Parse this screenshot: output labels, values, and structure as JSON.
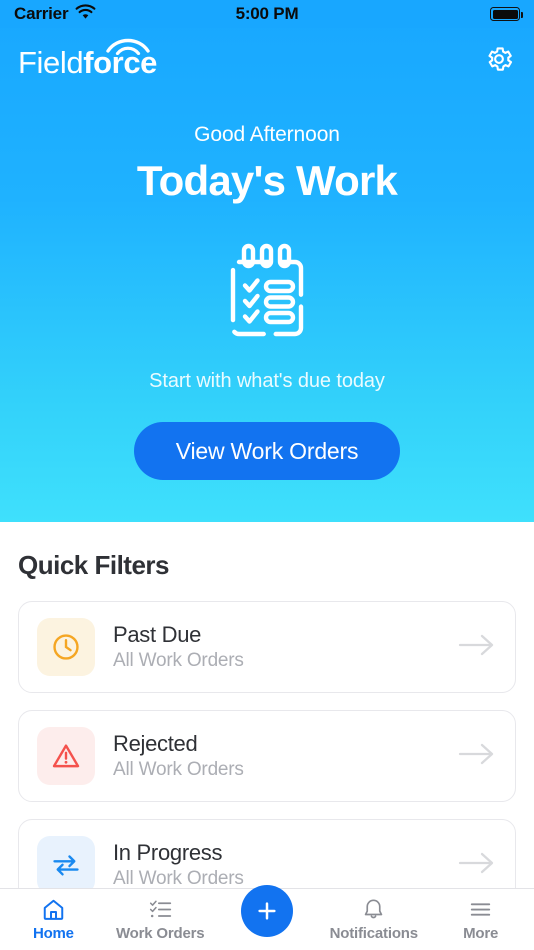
{
  "status_bar": {
    "carrier": "Carrier",
    "wifi_icon": "wifi-icon",
    "time": "5:00 PM",
    "battery_icon": "battery-full-icon"
  },
  "header": {
    "logo_part1": "Field",
    "logo_part2": "force",
    "logo_signal_icon": "signal-arc-icon",
    "settings_icon": "gear-icon"
  },
  "hero": {
    "greeting": "Good Afternoon",
    "title": "Today's Work",
    "illustration_icon": "clipboard-checklist-icon",
    "subtitle": "Start with what's due today",
    "cta_label": "View Work Orders"
  },
  "quick_filters": {
    "section_title": "Quick Filters",
    "items": [
      {
        "title": "Past Due",
        "subtitle": "All Work Orders",
        "icon": "clock-icon",
        "icon_color": "#F5A623",
        "tile_color": "#FCF3E0",
        "arrow_icon": "arrow-right-icon"
      },
      {
        "title": "Rejected",
        "subtitle": "All Work Orders",
        "icon": "warning-triangle-icon",
        "icon_color": "#F4524D",
        "tile_color": "#FDEDEC",
        "arrow_icon": "arrow-right-icon"
      },
      {
        "title": "In Progress",
        "subtitle": "All Work Orders",
        "icon": "exchange-arrows-icon",
        "icon_color": "#1989F0",
        "tile_color": "#E8F2FD",
        "arrow_icon": "arrow-right-icon"
      }
    ]
  },
  "bottom_nav": {
    "items": [
      {
        "label": "Home",
        "icon": "home-icon",
        "active": true
      },
      {
        "label": "Work Orders",
        "icon": "checklist-icon",
        "active": false
      },
      {
        "label": "Notifications",
        "icon": "bell-icon",
        "active": false
      },
      {
        "label": "More",
        "icon": "hamburger-menu-icon",
        "active": false
      }
    ],
    "fab_icon": "plus-icon"
  },
  "colors": {
    "brand_blue": "#18A7FF",
    "hero_gradient_end": "#3FE0FC",
    "accent_button": "#1273F0",
    "active_tab": "#1273F0",
    "inactive_tab": "#8A8C93",
    "text_primary": "#2F3136",
    "text_muted": "#ACAEB4"
  }
}
